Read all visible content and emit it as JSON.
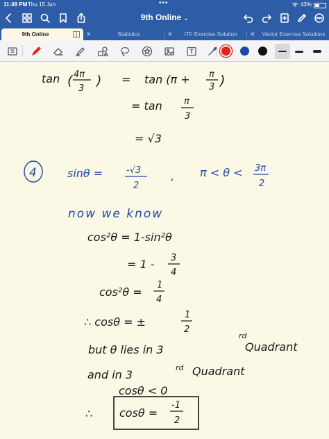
{
  "status": {
    "time": "11:49 PM",
    "date": "Thu 15 Jun",
    "battery": "43%",
    "battery_level": 0.43
  },
  "header": {
    "title": "9th Online"
  },
  "tabs": [
    {
      "label": "9th Online",
      "active": true
    },
    {
      "label": "Statistics",
      "active": false
    },
    {
      "label": "ITF Exercise Solution",
      "active": false
    },
    {
      "label": "Vector Exercise Solutions",
      "active": false
    }
  ],
  "colors": {
    "chrome": "#2c5da6",
    "paper": "#fbf8e6",
    "ink_black": "#1a1a1a",
    "ink_blue": "#1d49a5",
    "pen_red": "#e2251b"
  },
  "toolbar": {
    "text_tool": "T",
    "swatches": [
      "#e2251b",
      "#1d49a5",
      "#111111"
    ]
  },
  "notes": {
    "l1_tan": "tan",
    "l1_num": "4π",
    "l1_den": "3",
    "l1_eq": "=",
    "l1_rhs": "tan (π +",
    "l1_rnum": "π",
    "l1_rden": "3",
    "l1_close": ")",
    "l2": "= tan",
    "l2_num": "π",
    "l2_den": "3",
    "l3": "= √3",
    "q_number": "4",
    "q_sin": "sinθ =",
    "q_num": "-√3",
    "q_den": "2",
    "q_comma": ",",
    "q_range": "π < θ <",
    "q_rnum": "3π",
    "q_rden": "2",
    "now_we_know": "now we know",
    "s1": "cos²θ =  1-sin²θ",
    "s2": "= 1 -",
    "s2_num": "3",
    "s2_den": "4",
    "s3": "cos²θ =",
    "s3_num": "1",
    "s3_den": "4",
    "s4": "∴  cosθ =  ±",
    "s4_num": "1",
    "s4_den": "2",
    "s5": "but  θ  lies  in  3",
    "s5_sup": "rd",
    "s5_end": "Quadrant",
    "s6": "and  in  3",
    "s6_sup": "rd",
    "s6_end": "Quadrant",
    "s7": "cosθ < 0",
    "s8_therefore": "∴",
    "s8": "cosθ =",
    "s8_num": "-1",
    "s8_den": "2"
  }
}
